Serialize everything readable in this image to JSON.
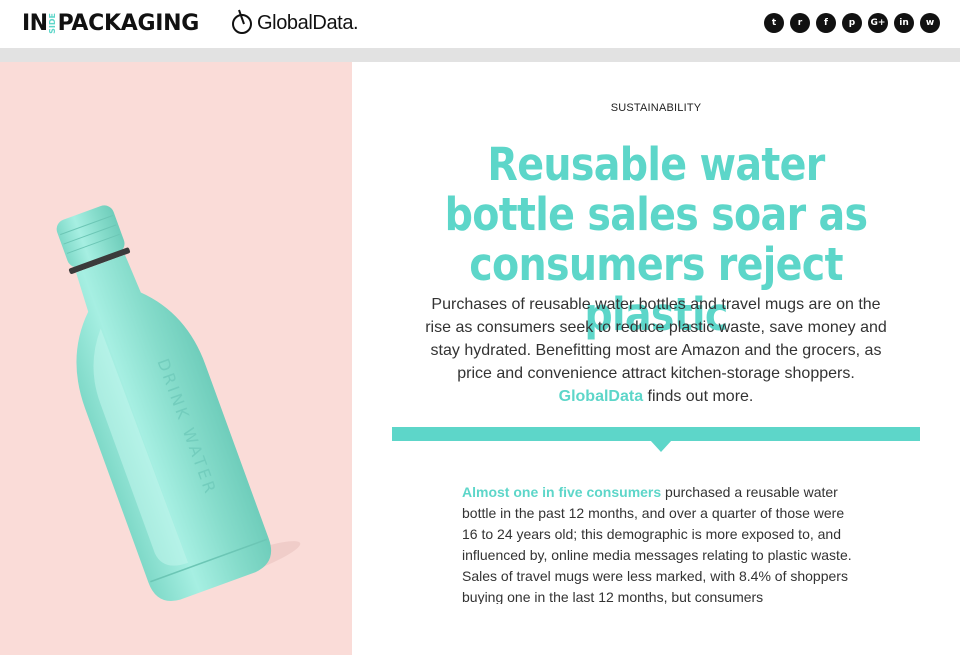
{
  "header": {
    "brand_in": "IN",
    "brand_side": "SIDE",
    "brand_packaging": "PACKAGING",
    "partner_logo": "GlobalData.",
    "social": [
      {
        "icon": "twitter-icon",
        "glyph": "t"
      },
      {
        "icon": "reddit-icon",
        "glyph": "r"
      },
      {
        "icon": "facebook-icon",
        "glyph": "f"
      },
      {
        "icon": "pinterest-icon",
        "glyph": "p"
      },
      {
        "icon": "google-plus-icon",
        "glyph": "G+"
      },
      {
        "icon": "linkedin-icon",
        "glyph": "in"
      },
      {
        "icon": "whatsapp-icon",
        "glyph": "w"
      }
    ]
  },
  "article": {
    "category": "SUSTAINABILITY",
    "headline": "Reusable water bottle sales soar as consumers reject plastic",
    "standfirst_before": "Purchases of reusable water bottles and travel mugs are on the rise as consumers seek to reduce plastic waste, save money and stay hydrated. Benefitting most are Amazon and the grocers, as price and convenience attract kitchen-storage shoppers.  ",
    "standfirst_link": "GlobalData",
    "standfirst_after": " finds out more.",
    "body_lead": "Almost one in five consumers",
    "body_rest": " purchased a reusable water bottle in the past 12 months, and over a quarter of those were 16 to 24 years old; this demographic is more exposed to, and influenced by, online media messages relating to plastic waste. Sales of travel mugs were less marked, with 8.4% of shoppers buying one in the last 12 months, but consumers"
  },
  "colors": {
    "accent": "#5dd6c9",
    "hero_background": "#fadcd8",
    "bottle": "#8fe3d4"
  }
}
